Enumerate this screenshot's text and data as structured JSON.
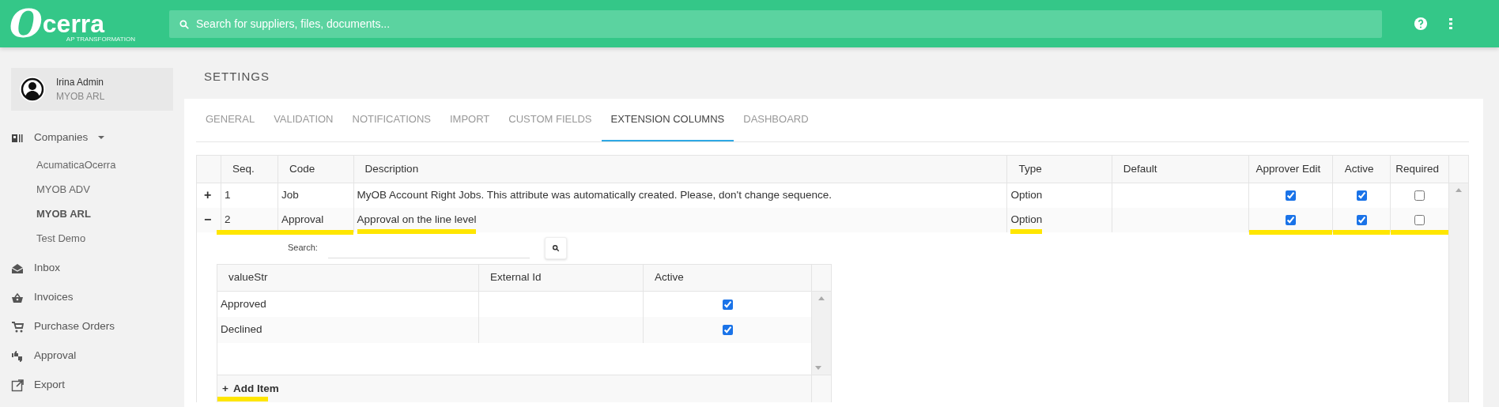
{
  "brand": {
    "mark": "O",
    "name": "cerra",
    "tagline": "AP TRANSFORMATION"
  },
  "search": {
    "placeholder": "Search for suppliers, files, documents..."
  },
  "user": {
    "name": "Irina Admin",
    "company": "MYOB ARL"
  },
  "companies": {
    "label": "Companies",
    "expanded": true,
    "items": [
      {
        "label": "AcumaticaOcerra",
        "selected": false
      },
      {
        "label": "MYOB ADV",
        "selected": false
      },
      {
        "label": "MYOB ARL",
        "selected": true
      },
      {
        "label": "Test Demo",
        "selected": false
      }
    ]
  },
  "nav": [
    {
      "label": "Inbox"
    },
    {
      "label": "Invoices"
    },
    {
      "label": "Purchase Orders"
    },
    {
      "label": "Approval"
    },
    {
      "label": "Export"
    }
  ],
  "page_title": "SETTINGS",
  "tabs": [
    {
      "label": "GENERAL",
      "selected": false
    },
    {
      "label": "VALIDATION",
      "selected": false
    },
    {
      "label": "NOTIFICATIONS",
      "selected": false
    },
    {
      "label": "IMPORT",
      "selected": false
    },
    {
      "label": "CUSTOM FIELDS",
      "selected": false
    },
    {
      "label": "EXTENSION COLUMNS",
      "selected": true
    },
    {
      "label": "DASHBOARD",
      "selected": false
    }
  ],
  "table": {
    "columns": [
      "Seq.",
      "Code",
      "Description",
      "Type",
      "Default",
      "Approver Edit",
      "Active",
      "Required"
    ],
    "rows": [
      {
        "toggle": "+",
        "expanded": false,
        "highlighted": false,
        "seq": "1",
        "code": "Job",
        "description": "MyOB Account Right Jobs. This attribute was automatically created. Please, don't change sequence.",
        "type": "Option",
        "approver_edit": true,
        "active": true,
        "required": false
      },
      {
        "toggle": "−",
        "expanded": true,
        "highlighted": true,
        "seq": "2",
        "code": "Approval",
        "description": "Approval on the line level",
        "type": "Option",
        "approver_edit": true,
        "active": true,
        "required": false
      }
    ]
  },
  "options": {
    "search_label": "Search:",
    "columns": [
      "valueStr",
      "External Id",
      "Active"
    ],
    "rows": [
      {
        "value": "Approved",
        "active": true
      },
      {
        "value": "Declined",
        "active": true
      }
    ],
    "add_item": {
      "icon": "+",
      "label": "Add Item",
      "highlighted": true
    }
  }
}
